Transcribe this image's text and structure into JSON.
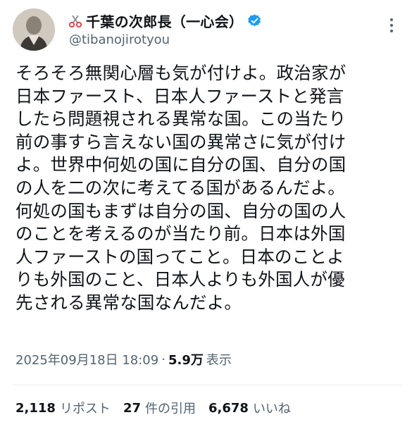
{
  "author": {
    "display_name": "千葉の次郎長（一心会）",
    "handle": "@tibanojirotyou",
    "verified_color": "#1d9bf0"
  },
  "icons": {
    "name_prefix": "scissors-icon",
    "verified": "verified-badge-icon",
    "more": "more-options-icon"
  },
  "post": {
    "lines": [
      "そろそろ無関心層も気が付けよ。政治家が",
      "日本ファースト、日本人ファーストと発言",
      "したら問題視される異常な国。この当たり",
      "前の事すら言えない国の異常さに気が付け",
      "よ。世界中何処の国に自分の国、自分の国",
      "の人を二の次に考えてる国があるんだよ。",
      "何処の国もまずは自分の国、自分の国の人",
      "のことを考えるのが当たり前。日本は外国",
      "人ファーストの国ってこと。日本のことよ",
      "りも外国のこと、日本人よりも外国人が優",
      "先される異常な国なんだよ。"
    ]
  },
  "meta": {
    "timestamp": "2025年09月18日 18:09",
    "separator": "·",
    "views_count": "5.9万",
    "views_label": "表示"
  },
  "stats": {
    "reposts_count": "2,118",
    "reposts_label": "リポスト",
    "quotes_count": "27",
    "quotes_label": "件の引用",
    "likes_count": "6,678",
    "likes_label": "いいね"
  }
}
